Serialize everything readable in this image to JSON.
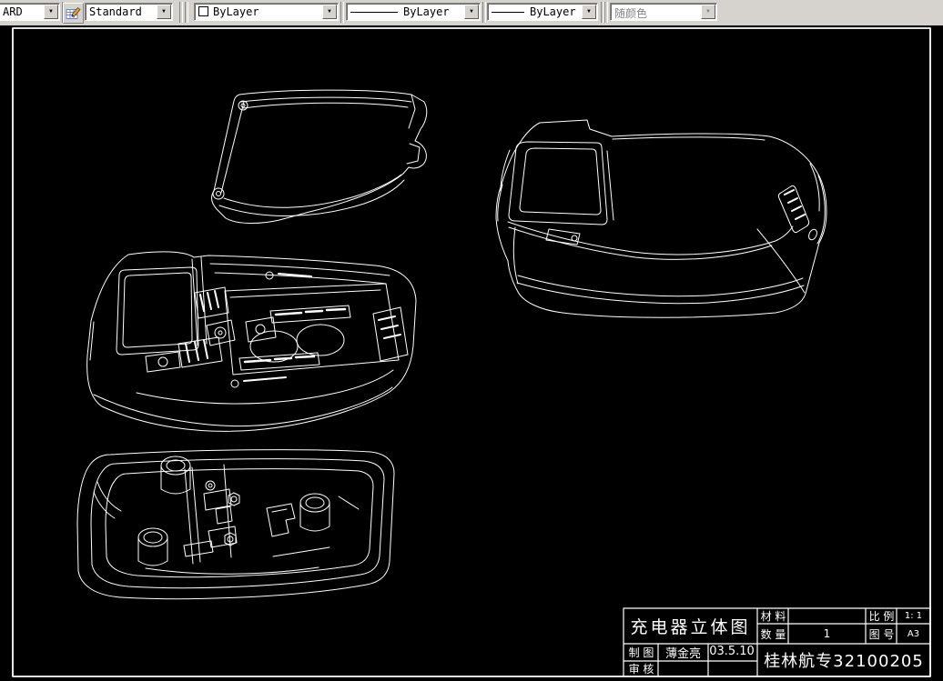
{
  "toolbar": {
    "style_value": "ARD",
    "text_style_value": "Standard",
    "color_value": "ByLayer",
    "linetype_value": "ByLayer",
    "lineweight_value": "ByLayer",
    "plot_style_value": "随颜色",
    "arrow_glyph": "▼",
    "icons": {
      "text_style_button": "text-style-table-pencil-icon",
      "color_swatch": "color-swatch-square",
      "linetype_sample": "line-sample-long",
      "lineweight_sample": "line-sample-short"
    }
  },
  "title_block": {
    "title": "充电器立体图",
    "material_label": "材 料",
    "material_value": "",
    "quantity_label": "数 量",
    "quantity_value": "1",
    "scale_label": "比 例",
    "scale_value": "1: 1",
    "sheet_label": "图 号",
    "sheet_value": "A3",
    "drawn_label": "制 图",
    "drawn_name": "薄金亮",
    "drawn_date": "03.5.10",
    "checked_label": "审 核",
    "org_number": "桂林航专32100205"
  },
  "colors": {
    "canvas_bg": "#000000",
    "line_color": "#ffffff",
    "toolbar_bg": "#d6d3ce",
    "disabled_text": "#848484"
  }
}
